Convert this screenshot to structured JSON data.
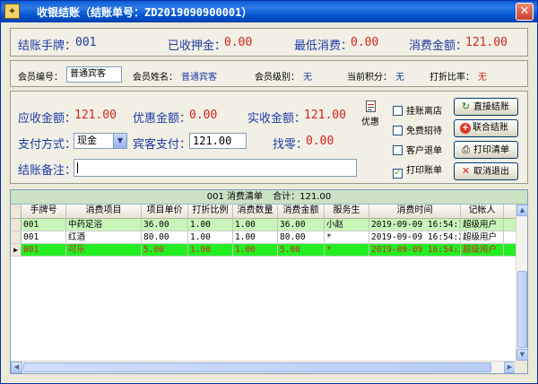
{
  "window": {
    "title": "收银结账（结账单号：ZD2019090900001）",
    "close_glyph": "✕"
  },
  "summary": {
    "bracelet_label": "结账手牌：",
    "bracelet_value": "001",
    "deposit_label": "已收押金：",
    "deposit_value": "0.00",
    "min_spend_label": "最低消费：",
    "min_spend_value": "0.00",
    "spend_label": "消费金额：",
    "spend_value": "121.00"
  },
  "member": {
    "id_label": "会员编号：",
    "id_value": "普通宾客",
    "name_label": "会员姓名：",
    "name_value": "普通宾客",
    "level_label": "会员级别：",
    "level_value": "无",
    "points_label": "当前积分：",
    "points_value": "无",
    "discount_label": "打折比率：",
    "discount_value": "无"
  },
  "payment": {
    "receivable_label": "应收金额：",
    "receivable_value": "121.00",
    "benefit_label": "优惠金额：",
    "benefit_value": "0.00",
    "actual_label": "实收金额：",
    "actual_value": "121.00",
    "method_label": "支付方式：",
    "method_value": "现金",
    "guest_pay_label": "宾客支付：",
    "guest_pay_value": "121.00",
    "change_label": "找零：",
    "change_value": "0.00",
    "remark_label": "结账备注：",
    "remark_value": "",
    "promo_label": "优惠"
  },
  "options": {
    "hang_label": "挂账离店",
    "hang_checked": false,
    "free_label": "免费招待",
    "free_checked": false,
    "refund_label": "客户退单",
    "refund_checked": false,
    "print_label": "打印账单",
    "print_checked": true
  },
  "buttons": {
    "direct": "直接结账",
    "combined": "联合结账",
    "print": "打印清单",
    "cancel": "取消退出"
  },
  "grid": {
    "caption_left": "001 消费清单",
    "caption_right": "合计：121.00",
    "columns": [
      "手牌号",
      "消费项目",
      "项目单价",
      "打折比例",
      "消费数量",
      "消费金额",
      "服务生",
      "消费时间",
      "记帐人"
    ],
    "rows": [
      [
        "001",
        "中药足浴",
        "36.00",
        "1.00",
        "1.00",
        "36.00",
        "小赵",
        "2019-09-09 16:54:19",
        "超级用户"
      ],
      [
        "001",
        "红酒",
        "80.00",
        "1.00",
        "1.00",
        "80.00",
        "*",
        "2019-09-09 16:54:22",
        "超级用户"
      ],
      [
        "001",
        "可乐",
        "5.00",
        "1.00",
        "1.00",
        "5.00",
        "*",
        "2019-09-09 16:54:23",
        "超级用户"
      ]
    ],
    "current_row_marker": "▶"
  },
  "colors": {
    "title_bar": "#0a5bd6",
    "label_blue": "#1d3aa8",
    "value_red": "#d4241c",
    "row_selected": "#22ee22"
  }
}
